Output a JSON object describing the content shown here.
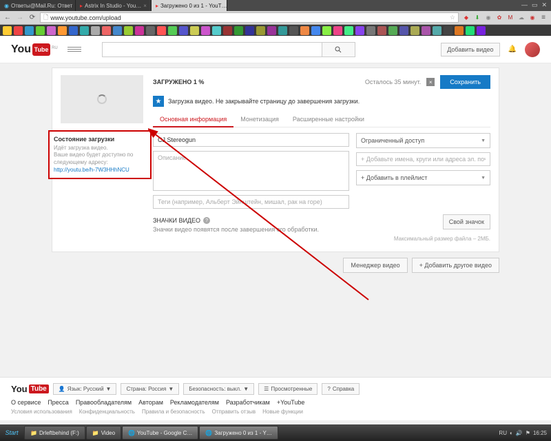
{
  "browser": {
    "tabs": [
      {
        "title": "Ответы@Mail.Ru: Ответ"
      },
      {
        "title": "Astrix In Studio - You…"
      },
      {
        "title": "Загружено 0 из 1 - YouT…"
      }
    ],
    "url": "www.youtube.com/upload"
  },
  "yt_header": {
    "logo_text": "YouTube",
    "logo_sub": "RU",
    "upload_label": "Добавить видео"
  },
  "upload": {
    "status_title": "ЗАГРУЖЕНО 1 %",
    "time_left": "Осталось 35 минут.",
    "save_label": "Сохранить",
    "notice": "Загрузка видео. Не закрывайте страницу до завершения загрузки.",
    "tabs": {
      "basic": "Основная информация",
      "monet": "Монетизация",
      "adv": "Расширенные настройки"
    },
    "title_value": "CJ Stereogun",
    "desc_placeholder": "Описание",
    "tags_placeholder": "Теги (например, Альберт Эйнштейн, мишал, рак на горе)",
    "privacy": "Ограниченный доступ",
    "share_placeholder": "+ Добавьте имена, круги или адреса эл. почты",
    "playlist_label": "+ Добавить в плейлист",
    "thumbs_title": "ЗНАЧКИ ВИДЕО",
    "thumbs_note": "Значки видео появятся после завершения его обработки.",
    "custom_thumb": "Свой значок",
    "max_size": "Максимальный размер файла – 2МБ."
  },
  "sidebar": {
    "heading": "Состояние загрузки",
    "line1": "Идёт загрузка видео.",
    "line2": "Ваше видео будет доступно по следующему адресу:",
    "link": "http://youtu.be/h-7W3HHhNCU"
  },
  "below": {
    "manager": "Менеджер видео",
    "another": "+ Добавить другое видео"
  },
  "footer": {
    "lang": "Язык: Русский",
    "country": "Страна: Россия",
    "safety": "Безопасность: выкл.",
    "history": "Просмотренные",
    "help": "Справка",
    "links1": [
      "О сервисе",
      "Пресса",
      "Правообладателям",
      "Авторам",
      "Рекламодателям",
      "Разработчикам",
      "+YouTube"
    ],
    "links2": [
      "Условия использования",
      "Конфиденциальность",
      "Правила и безопасность",
      "Отправить отзыв",
      "Новые функции"
    ]
  },
  "taskbar": {
    "items": [
      "Drleftbehind (F:)",
      "Video",
      "YouTube - Google C…",
      "Загружено 0 из 1 - Y…"
    ],
    "lang": "RU",
    "time": "16:25"
  }
}
